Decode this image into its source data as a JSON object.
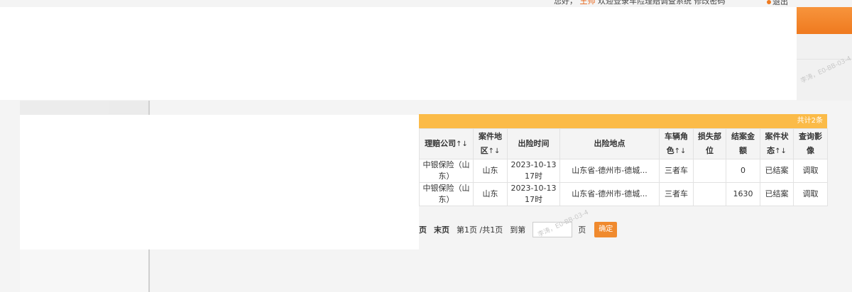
{
  "header": {
    "user_info_label": "您好，",
    "user_name": "王帅",
    "system_welcome": "欢迎登录车险理赔调查系统",
    "change_password": "修改密码",
    "logout": "退出"
  },
  "watermark": "李涛，E0-BB-03-4",
  "table": {
    "total_label": "共计2条",
    "columns": [
      {
        "label": "理赔公司",
        "sort": "↑↓"
      },
      {
        "label": "案件地区",
        "sort": "↑↓"
      },
      {
        "label": "出险时间",
        "sort": ""
      },
      {
        "label": "出险地点",
        "sort": ""
      },
      {
        "label": "车辆角色",
        "sort": "↑↓"
      },
      {
        "label": "损失部位",
        "sort": ""
      },
      {
        "label": "结案金额",
        "sort": ""
      },
      {
        "label": "案件状态",
        "sort": "↑↓"
      },
      {
        "label": "查询影像",
        "sort": ""
      }
    ],
    "rows": [
      {
        "company": "中银保险（山东）",
        "region": "山东",
        "time": "2023-10-13 17时",
        "location": "山东省-德州市-德城...",
        "role": "三者车",
        "damage": "",
        "amount": "0",
        "status": "已结案",
        "action": "调取"
      },
      {
        "company": "中银保险（山东）",
        "region": "山东",
        "time": "2023-10-13 17时",
        "location": "山东省-德州市-德城...",
        "role": "三者车",
        "damage": "",
        "amount": "1630",
        "status": "已结案",
        "action": "调取"
      }
    ]
  },
  "pagination": {
    "prev_tail": "页",
    "last_page": "末页",
    "page_info": "第1页 /共1页",
    "goto_label": "到第",
    "page_unit": "页",
    "confirm": "确定"
  }
}
